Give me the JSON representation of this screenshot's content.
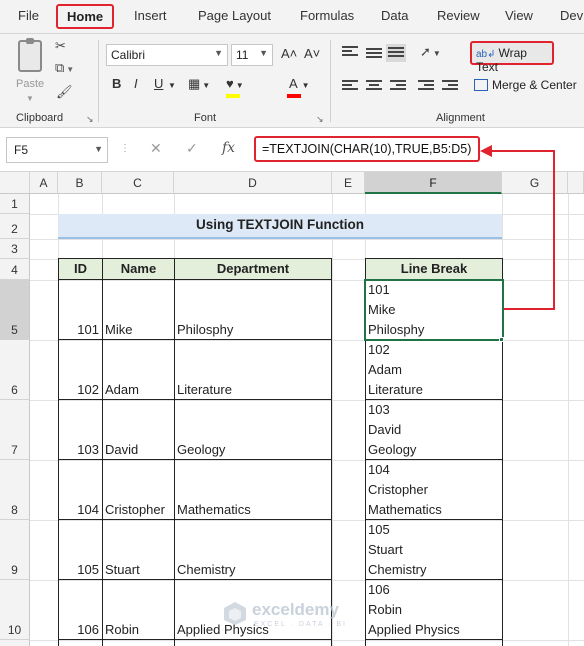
{
  "ribbon_tabs": [
    "File",
    "Home",
    "Insert",
    "Page Layout",
    "Formulas",
    "Data",
    "Review",
    "View",
    "Dev"
  ],
  "ribbon": {
    "clipboard": {
      "paste_label": "Paste",
      "group_label": "Clipboard"
    },
    "font": {
      "font_name": "Calibri",
      "font_size": "11",
      "grow_label": "A˄",
      "shrink_label": "A˅",
      "bold": "B",
      "italic": "I",
      "underline": "U",
      "font_color_label": "A",
      "group_label": "Font",
      "fill_color": "#FFFF00",
      "font_color": "#FF0000"
    },
    "alignment": {
      "wrap_text_label": "Wrap Text",
      "merge_label": "Merge & Center",
      "group_label": "Alignment"
    }
  },
  "formula_bar": {
    "name_box": "F5",
    "fx_label": "fx",
    "formula": "=TEXTJOIN(CHAR(10),TRUE,B5:D5)"
  },
  "sheet": {
    "columns": [
      "A",
      "B",
      "C",
      "D",
      "E",
      "F",
      "G"
    ],
    "rows": [
      "1",
      "2",
      "3",
      "4",
      "5",
      "6",
      "7",
      "8",
      "9",
      "10"
    ],
    "title": "Using TEXTJOIN Function",
    "headers": {
      "id": "ID",
      "name": "Name",
      "department": "Department",
      "line_break": "Line Break"
    },
    "records": [
      {
        "id": "101",
        "name": "Mike",
        "department": "Philosphy",
        "lines": [
          "101",
          "Mike",
          "Philosphy"
        ]
      },
      {
        "id": "102",
        "name": "Adam",
        "department": "Literature",
        "lines": [
          "102",
          "Adam",
          "Literature"
        ]
      },
      {
        "id": "103",
        "name": "David",
        "department": "Geology",
        "lines": [
          "103",
          "David",
          "Geology"
        ]
      },
      {
        "id": "104",
        "name": "Cristopher",
        "department": "Mathematics",
        "lines": [
          "104",
          "Cristopher",
          "Mathematics"
        ]
      },
      {
        "id": "105",
        "name": "Stuart",
        "department": "Chemistry",
        "lines": [
          "105",
          "Stuart",
          "Chemistry"
        ]
      },
      {
        "id": "106",
        "name": "Robin",
        "department": "Applied Physics",
        "lines": [
          "106",
          "Robin",
          "Applied Physics"
        ]
      }
    ]
  },
  "watermark": {
    "name": "exceldemy",
    "tagline": "EXCEL · DATA · BI"
  },
  "colors": {
    "accent_red": "#E1232F",
    "excel_green": "#217346",
    "title_fill": "#DDE9F6",
    "header_fill": "#E3EFDA"
  }
}
